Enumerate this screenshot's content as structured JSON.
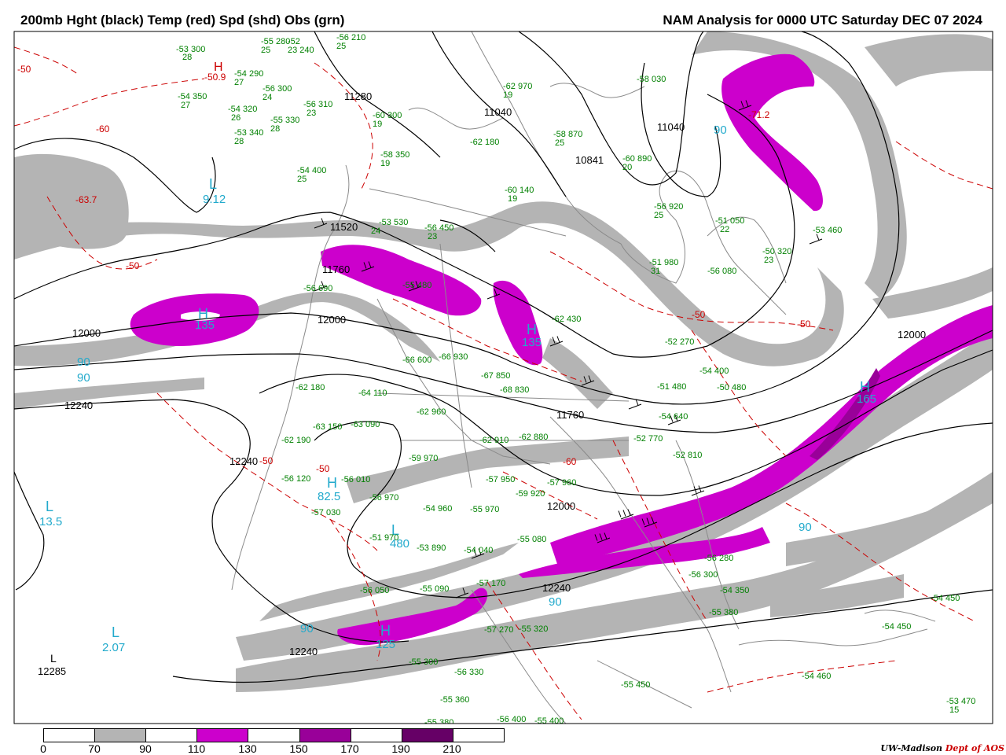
{
  "header": {
    "left_title": "200mb Hght (black) Temp (red) Spd (shd) Obs (grn)",
    "right_title": "NAM Analysis for 0000 UTC Saturday  DEC 07 2024"
  },
  "colors": {
    "height_contour": "#000000",
    "temp_contour": "#cc0000",
    "obs": "#008000",
    "pressure_center": "#22aacc",
    "coastline": "#8a8a8a",
    "speed_70_90": "#b4b4b4",
    "speed_110_130": "#cc00cc",
    "speed_150_170": "#990099",
    "speed_190_210": "#660066"
  },
  "legend": {
    "labels": [
      "0",
      "70",
      "90",
      "110",
      "130",
      "150",
      "170",
      "190",
      "210"
    ],
    "segment_colors": [
      "#ffffff",
      "#b4b4b4",
      "#ffffff",
      "#cc00cc",
      "#ffffff",
      "#990099",
      "#ffffff",
      "#660066",
      "#ffffff"
    ]
  },
  "height_labels": [
    "11280",
    "11040",
    "11040",
    "10841",
    "11520",
    "11760",
    "12000",
    "12000",
    "12000",
    "12240",
    "12240",
    "12240",
    "12240",
    "12000",
    "11760",
    "12285"
  ],
  "temp_labels": [
    "-50",
    "-60",
    "-63.7",
    "-50",
    "-50",
    "-50",
    "-50",
    "-60",
    "-50",
    "-71.2",
    "-50.9"
  ],
  "centers": [
    {
      "type": "H",
      "value": "-50.9",
      "color": "red"
    },
    {
      "type": "L",
      "value": "9.12",
      "color": "cyan"
    },
    {
      "type": "H",
      "value": "135",
      "color": "cyan"
    },
    {
      "type": "H",
      "value": "82.5",
      "color": "cyan"
    },
    {
      "type": "L",
      "value": "13.5",
      "color": "cyan"
    },
    {
      "type": "L",
      "value": "2.07",
      "color": "cyan"
    },
    {
      "type": "H",
      "value": "135",
      "color": "cyan"
    },
    {
      "type": "H",
      "value": "165",
      "color": "cyan"
    },
    {
      "type": "H",
      "value": "125",
      "color": "cyan"
    },
    {
      "type": "L",
      "value": "480",
      "color": "cyan"
    },
    {
      "type": "L",
      "value": "",
      "color": "black"
    }
  ],
  "speed_labels": [
    "90",
    "90",
    "90",
    "90",
    "90",
    "90"
  ],
  "observations": [
    "-53 300",
    "28",
    "-55 280",
    "25",
    "-52",
    "23 240",
    "-56 210",
    "25",
    "-54 290",
    "27",
    "-56 300",
    "24",
    "-54 350",
    "27",
    "-54 320",
    "26",
    "-56 310",
    "23",
    "-55 330",
    "28",
    "-53 340",
    "28",
    "-60 300",
    "19",
    "-58 350",
    "19",
    "-54 400",
    "25",
    "-62 970",
    "19",
    "-62 180",
    "-58 870",
    "25",
    "-58 030",
    "-60 890",
    "20",
    "-60 140",
    "19",
    "-56 920",
    "25",
    "-51 050",
    "22",
    "-51 980",
    "31",
    "-56 080",
    "-50 320",
    "23",
    "-53 460",
    "-53 530",
    "24",
    "-56 450",
    "23",
    "-55 480",
    "-56 690",
    "-62 430",
    "-52 270",
    "-66 600",
    "-66 930",
    "-67 850",
    "-68 830",
    "-62 180",
    "-64 110",
    "-62 960",
    "-63 150",
    "-62 190",
    "-63 090",
    "-62 910",
    "-62 880",
    "-52 770",
    "-54 400",
    "-51 480",
    "-50 480",
    "-54 640",
    "-52 810",
    "-59 970",
    "-56 120",
    "-56 010",
    "-56 970",
    "-57 950",
    "-57 960",
    "-59 920",
    "-57 030",
    "-54 960",
    "-55 970",
    "-51 970",
    "-53 890",
    "-54 040",
    "-55 080",
    "-56 050",
    "-55 090",
    "-57 170",
    "-56 280",
    "-56 300",
    "-54 350",
    "-55 380",
    "-54 450",
    "-54 450",
    "-57 270",
    "-55 320",
    "-55 300",
    "-56 330",
    "-55 360",
    "-55 380",
    "-56 400",
    "-55 400",
    "-55 450",
    "-54 460",
    "-53 470",
    "15"
  ],
  "credit": {
    "org": "UW-Madison",
    "dept": "Dept of AOS"
  }
}
